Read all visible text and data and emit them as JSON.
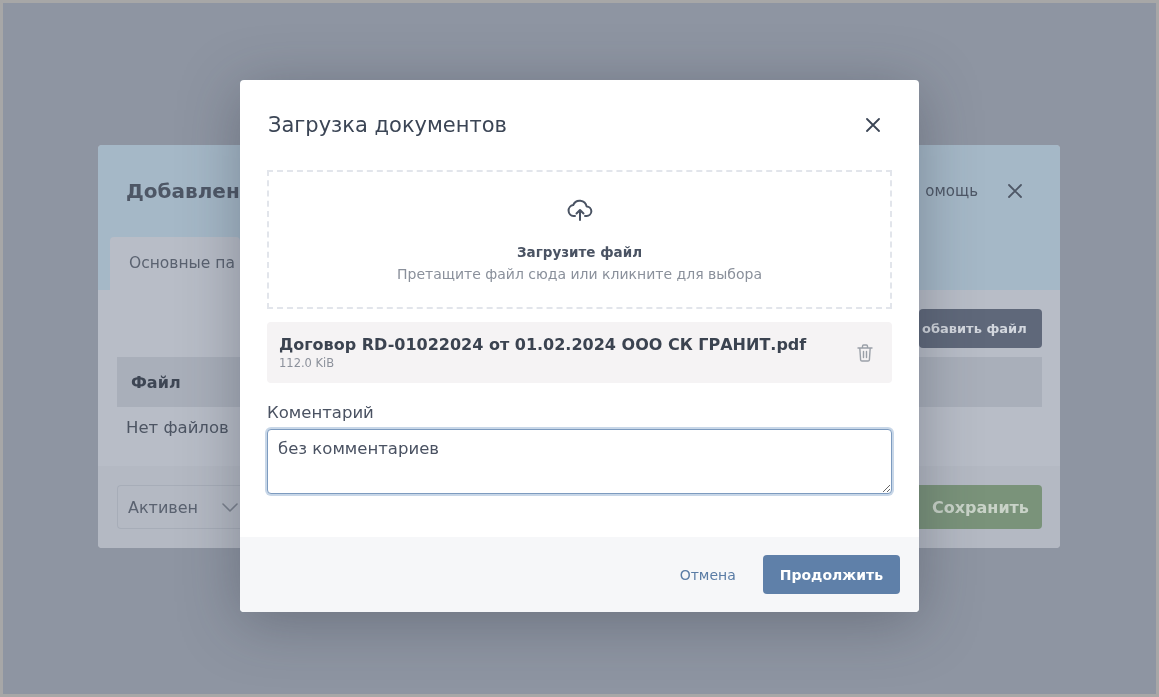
{
  "background_dialog": {
    "title": "Добавлен",
    "help_link": "омощь",
    "tabs": [
      {
        "label": "Основные па",
        "selected": true
      }
    ],
    "add_file_button": "обавить файл",
    "files_table": {
      "columns": [
        "Файл"
      ],
      "empty_text": "Нет файлов"
    },
    "status_select": {
      "value": "Активен"
    },
    "save_button": "Сохранить"
  },
  "upload_modal": {
    "title": "Загрузка документов",
    "dropzone": {
      "title": "Загрузите файл",
      "hint": "Претащите файл сюда или кликните для выбора"
    },
    "files": [
      {
        "name": "Договор RD-01022024 от 01.02.2024 ООО СК ГРАНИТ.pdf",
        "size": "112.0 KiB"
      }
    ],
    "comment": {
      "label": "Коментарий",
      "value": "без комментариев",
      "focused": true
    },
    "buttons": [
      {
        "label": "Отмена",
        "kind": "link"
      },
      {
        "label": "Продолжить",
        "kind": "primary"
      }
    ]
  }
}
